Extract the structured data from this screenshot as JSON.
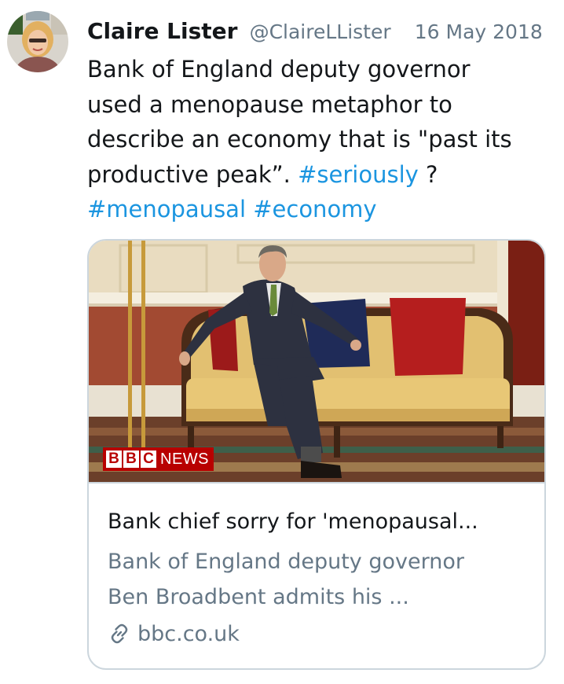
{
  "author": {
    "display_name": "Claire Lister",
    "handle": "@ClaireLLister",
    "avatar_icon": "profile-photo"
  },
  "tweet": {
    "date": "16 May 2018",
    "text_lines": [
      "Bank of England deputy governor",
      "used a menopause metaphor to",
      "describe an economy that is \"past its"
    ],
    "line4_text": "productive peak”. ",
    "line4_hashtag": "#seriously",
    "line4_suffix": " ?",
    "hashtag_menopausal": "#menopausal",
    "hashtag_economy": "#economy",
    "hashtag_color": "#1b95e0"
  },
  "card": {
    "image_badge": {
      "blocks": [
        "B",
        "B",
        "C"
      ],
      "label": "NEWS",
      "color": "#b80000"
    },
    "title": "Bank chief sorry for 'menopausal...",
    "description_lines": [
      "Bank of England deputy governor",
      "Ben Broadbent admits his ..."
    ],
    "domain": "bbc.co.uk",
    "link_icon": "link-icon"
  }
}
